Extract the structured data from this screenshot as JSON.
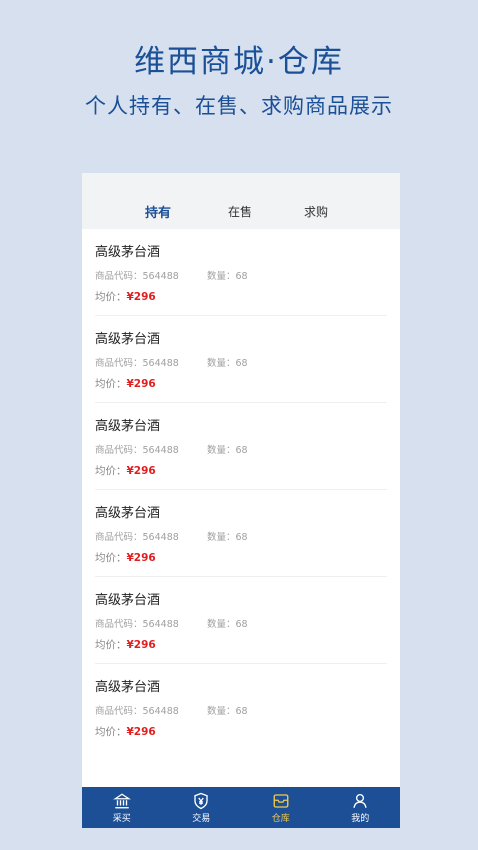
{
  "hero": {
    "title": "维西商城·仓库",
    "subtitle": "个人持有、在售、求购商品展示"
  },
  "tabs": [
    {
      "label": "持有",
      "active": true
    },
    {
      "label": "在售",
      "active": false
    },
    {
      "label": "求购",
      "active": false
    }
  ],
  "items": [
    {
      "name": "高级茅台酒",
      "code_label": "商品代码：",
      "code": "564488",
      "qty_label": "数量：",
      "qty": "68",
      "price_label": "均价：",
      "price": "¥296"
    },
    {
      "name": "高级茅台酒",
      "code_label": "商品代码：",
      "code": "564488",
      "qty_label": "数量：",
      "qty": "68",
      "price_label": "均价：",
      "price": "¥296"
    },
    {
      "name": "高级茅台酒",
      "code_label": "商品代码：",
      "code": "564488",
      "qty_label": "数量：",
      "qty": "68",
      "price_label": "均价：",
      "price": "¥296"
    },
    {
      "name": "高级茅台酒",
      "code_label": "商品代码：",
      "code": "564488",
      "qty_label": "数量：",
      "qty": "68",
      "price_label": "均价：",
      "price": "¥296"
    },
    {
      "name": "高级茅台酒",
      "code_label": "商品代码：",
      "code": "564488",
      "qty_label": "数量：",
      "qty": "68",
      "price_label": "均价：",
      "price": "¥296"
    },
    {
      "name": "高级茅台酒",
      "code_label": "商品代码：",
      "code": "564488",
      "qty_label": "数量：",
      "qty": "68",
      "price_label": "均价：",
      "price": "¥296"
    }
  ],
  "tabbar": [
    {
      "label": "采买",
      "icon": "bank-icon",
      "active": false
    },
    {
      "label": "交易",
      "icon": "yen-shield-icon",
      "active": false
    },
    {
      "label": "仓库",
      "icon": "warehouse-box-icon",
      "active": true
    },
    {
      "label": "我的",
      "icon": "person-icon",
      "active": false
    }
  ],
  "colors": {
    "primary": "#1d4f96",
    "price": "#e02020",
    "active_tab_icon": "#f2c94c",
    "background": "#d6e0ee"
  }
}
